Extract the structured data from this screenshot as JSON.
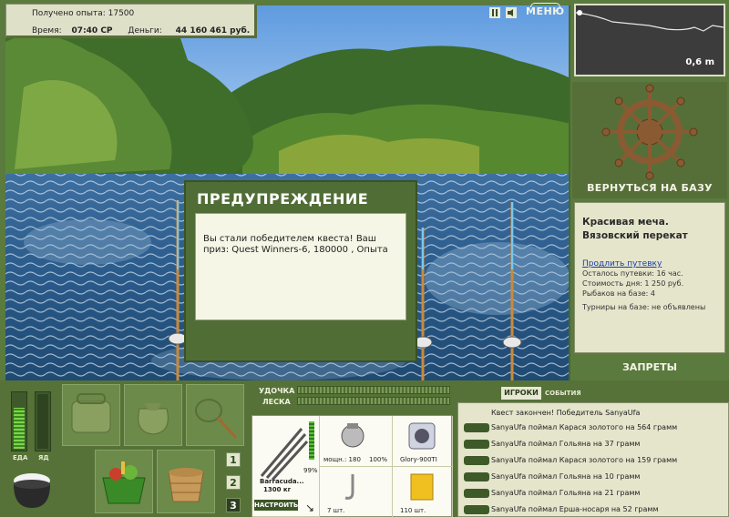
{
  "stats": {
    "xp_label": "Получено опыта:",
    "xp_value": "17500",
    "time_label": "Время:",
    "time_value": "07:40 СР",
    "money_label": "Деньги:",
    "money_value": "44 160 461 руб."
  },
  "toolbar": {
    "pause_icon": "pause-icon",
    "sound_icon": "sound-icon",
    "menu_label": "МЕНЮ"
  },
  "depth": {
    "value": "0,6 m"
  },
  "base": {
    "return_label": "ВЕРНУТЬСЯ НА БАЗУ",
    "name_line1": "Красивая меча.",
    "name_line2": "Вязовский перекат",
    "extend_link": "Продлить путевку",
    "remaining": "Осталось путевки: 16 час.",
    "day_cost": "Стоимость дня: 1 250 руб.",
    "fishers": "Рыбаков на базе: 4",
    "tournaments": "Турниры на базе: не объявлены",
    "bans_label": "ЗАПРЕТЫ"
  },
  "meters": {
    "food_label": "ЕДА",
    "poison_label": "ЯД",
    "food_level": 0.72,
    "poison_level": 0.0
  },
  "slots": {
    "numbers": [
      "1",
      "2",
      "3"
    ]
  },
  "tackle": {
    "rod_label": "УДОЧКА",
    "line_label": "ЛЕСКА",
    "rod_health": "99%",
    "rod_name": "Barracuda...",
    "rod_weight": "1300 кг",
    "setup_label": "НАСТРОИТЬ",
    "reel_power": "мощн.: 180",
    "reel_health": "100%",
    "line_name": "Glory-900TI",
    "hook_count": "7 шт.",
    "bait_count": "110 шт."
  },
  "events": {
    "tab_players": "ИГРОКИ",
    "tab_events": "СОБЫТИЯ",
    "items": [
      "Квест закончен! Победитель SanyaUfa",
      "SanyaUfa поймал Карася золотого на 564 грамм",
      "SanyaUfa поймал Гольяна на 37 грамм",
      "SanyaUfa поймал Карася золотого на 159 грамм",
      "SanyaUfa поймал Гольяна на 10 грамм",
      "SanyaUfa поймал Гольяна на 21 грамм",
      "SanyaUfa поймал Ерша-носаря на 52 грамм"
    ]
  },
  "dialog": {
    "title": "ПРЕДУПРЕЖДЕНИЕ",
    "message": "Вы стали победителем квеста! Ваш приз: Quest Winners-6, 180000 , Опыта"
  },
  "colors": {
    "panel_green": "#567238",
    "panel_cream": "#e5e5cc",
    "link_blue": "#1a3ca8"
  }
}
